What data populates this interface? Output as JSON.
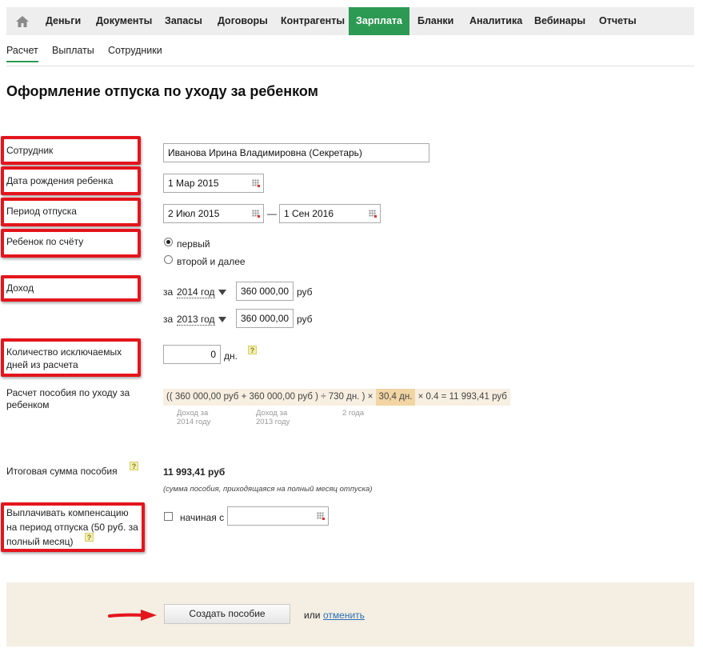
{
  "nav": {
    "items": [
      "Деньги",
      "Документы",
      "Запасы",
      "Договоры",
      "Контрагенты",
      "Зарплата",
      "Бланки",
      "Аналитика",
      "Вебинары",
      "Отчеты"
    ],
    "active": "Зарплата"
  },
  "subnav": {
    "items": [
      "Расчет",
      "Выплаты",
      "Сотрудники"
    ],
    "active": "Расчет"
  },
  "page_title": "Оформление отпуска по уходу за ребенком",
  "form": {
    "employee_label": "Сотрудник",
    "employee_value": "Иванова Ирина Владимировна (Секретарь)",
    "birth_label": "Дата рождения ребенка",
    "birth_value": "1 Мар 2015",
    "period_label": "Период отпуска",
    "period_from": "2 Июл 2015",
    "period_dash": "—",
    "period_to": "1 Сен 2016",
    "child_label": "Ребенок по счёту",
    "child_opt1": "первый",
    "child_opt2": "второй и далее",
    "income_label": "Доход",
    "income_prefix": "за",
    "income_year1": "2014 год",
    "income_value1": "360 000,00",
    "income_year2": "2013 год",
    "income_value2": "360 000,00",
    "currency": "руб",
    "excluded_label_1": "Количество исключаемых",
    "excluded_label_2": "дней из расчета",
    "excluded_value": "0",
    "excluded_unit": "дн.",
    "calc_label_1": "Расчет пособия по уходу за",
    "calc_label_2": "ребенком",
    "total_label": "Итоговая сумма пособия",
    "total_value": "11 993,41 руб",
    "total_note": "(сумма пособия, приходящаяся на полный месяц отпуска)",
    "comp_label_1": "Выплачивать компенсацию",
    "comp_label_2": "на период отпуска (50 руб. за",
    "comp_label_3": "полный месяц)",
    "comp_from_label": "начиная с",
    "comp_from_value": ""
  },
  "formula": {
    "open": "((",
    "v1": "360 000,00 руб",
    "plus": "+",
    "v2": "360 000,00 руб",
    "close": ")",
    "div": "÷",
    "days": "730 дн.",
    "close2": ")",
    "times": "×",
    "mid": "30,4 дн.",
    "tail": "× 0.4 = 11 993,41 руб",
    "note1_a": "Доход за",
    "note1_b": "2014 году",
    "note2_a": "Доход за",
    "note2_b": "2013 году",
    "note3": "2 года"
  },
  "footer": {
    "create_button": "Создать пособие",
    "or": "или",
    "cancel": "отменить"
  },
  "help_glyph": "?",
  "colors": {
    "accent": "#2d9a53",
    "highlight_box": "#e4151d",
    "link": "#2a6fb3"
  }
}
